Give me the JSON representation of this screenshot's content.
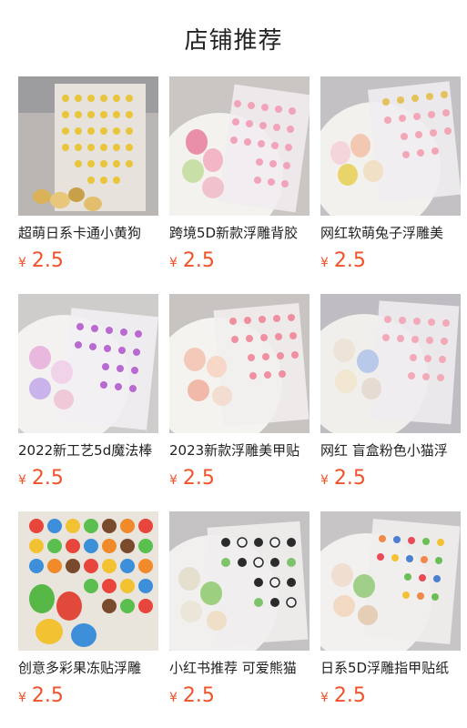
{
  "header": {
    "title": "店铺推荐"
  },
  "products": [
    {
      "name": "超萌日系卡通小黄狗",
      "currency": "¥",
      "price": "2.5",
      "image": "sticker-sheet-yellow-dog"
    },
    {
      "name": "跨境5D新款浮雕背胶",
      "currency": "¥",
      "price": "2.5",
      "image": "sticker-sheet-pink"
    },
    {
      "name": "网红软萌兔子浮雕美",
      "currency": "¥",
      "price": "2.5",
      "image": "sticker-sheet-bunny"
    },
    {
      "name": "2022新工艺5d魔法棒",
      "currency": "¥",
      "price": "2.5",
      "image": "sticker-sheet-purple-wand"
    },
    {
      "name": "2023新款浮雕美甲贴",
      "currency": "¥",
      "price": "2.5",
      "image": "sticker-sheet-pink-floral"
    },
    {
      "name": "网红 盲盒粉色小猫浮",
      "currency": "¥",
      "price": "2.5",
      "image": "sticker-sheet-cat"
    },
    {
      "name": "创意多彩果冻贴浮雕",
      "currency": "¥",
      "price": "2.5",
      "image": "sticker-sheet-jelly-candy"
    },
    {
      "name": "小红书推荐 可爱熊猫",
      "currency": "¥",
      "price": "2.5",
      "image": "sticker-sheet-panda"
    },
    {
      "name": "日系5D浮雕指甲贴纸",
      "currency": "¥",
      "price": "2.5",
      "image": "sticker-sheet-colorful"
    }
  ]
}
